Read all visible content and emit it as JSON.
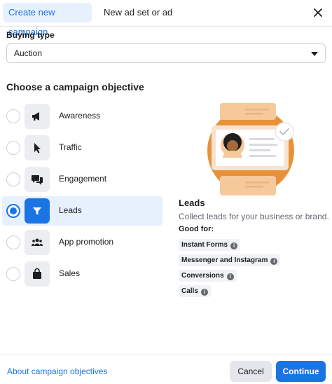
{
  "tabs": [
    {
      "label": "Create new campaign"
    },
    {
      "label": "New ad set or ad"
    }
  ],
  "buying_type": {
    "label": "Buying type",
    "value": "Auction"
  },
  "objective_title": "Choose a campaign objective",
  "objectives": [
    {
      "label": "Awareness",
      "icon": "megaphone-icon"
    },
    {
      "label": "Traffic",
      "icon": "cursor-icon"
    },
    {
      "label": "Engagement",
      "icon": "chat-bubbles-icon"
    },
    {
      "label": "Leads",
      "icon": "funnel-icon",
      "selected": true
    },
    {
      "label": "App promotion",
      "icon": "people-icon"
    },
    {
      "label": "Sales",
      "icon": "shopping-bag-icon"
    }
  ],
  "detail": {
    "title": "Leads",
    "description": "Collect leads for your business or brand.",
    "good_for_label": "Good for:",
    "good_for": [
      "Instant Forms",
      "Messenger and Instagram",
      "Conversions",
      "Calls"
    ]
  },
  "footer": {
    "about_link": "About campaign objectives",
    "cancel": "Cancel",
    "continue": "Continue"
  },
  "colors": {
    "accent": "#1b74e4",
    "selected_bg": "#e7f0fd",
    "illustration_orange": "#e8913a"
  }
}
